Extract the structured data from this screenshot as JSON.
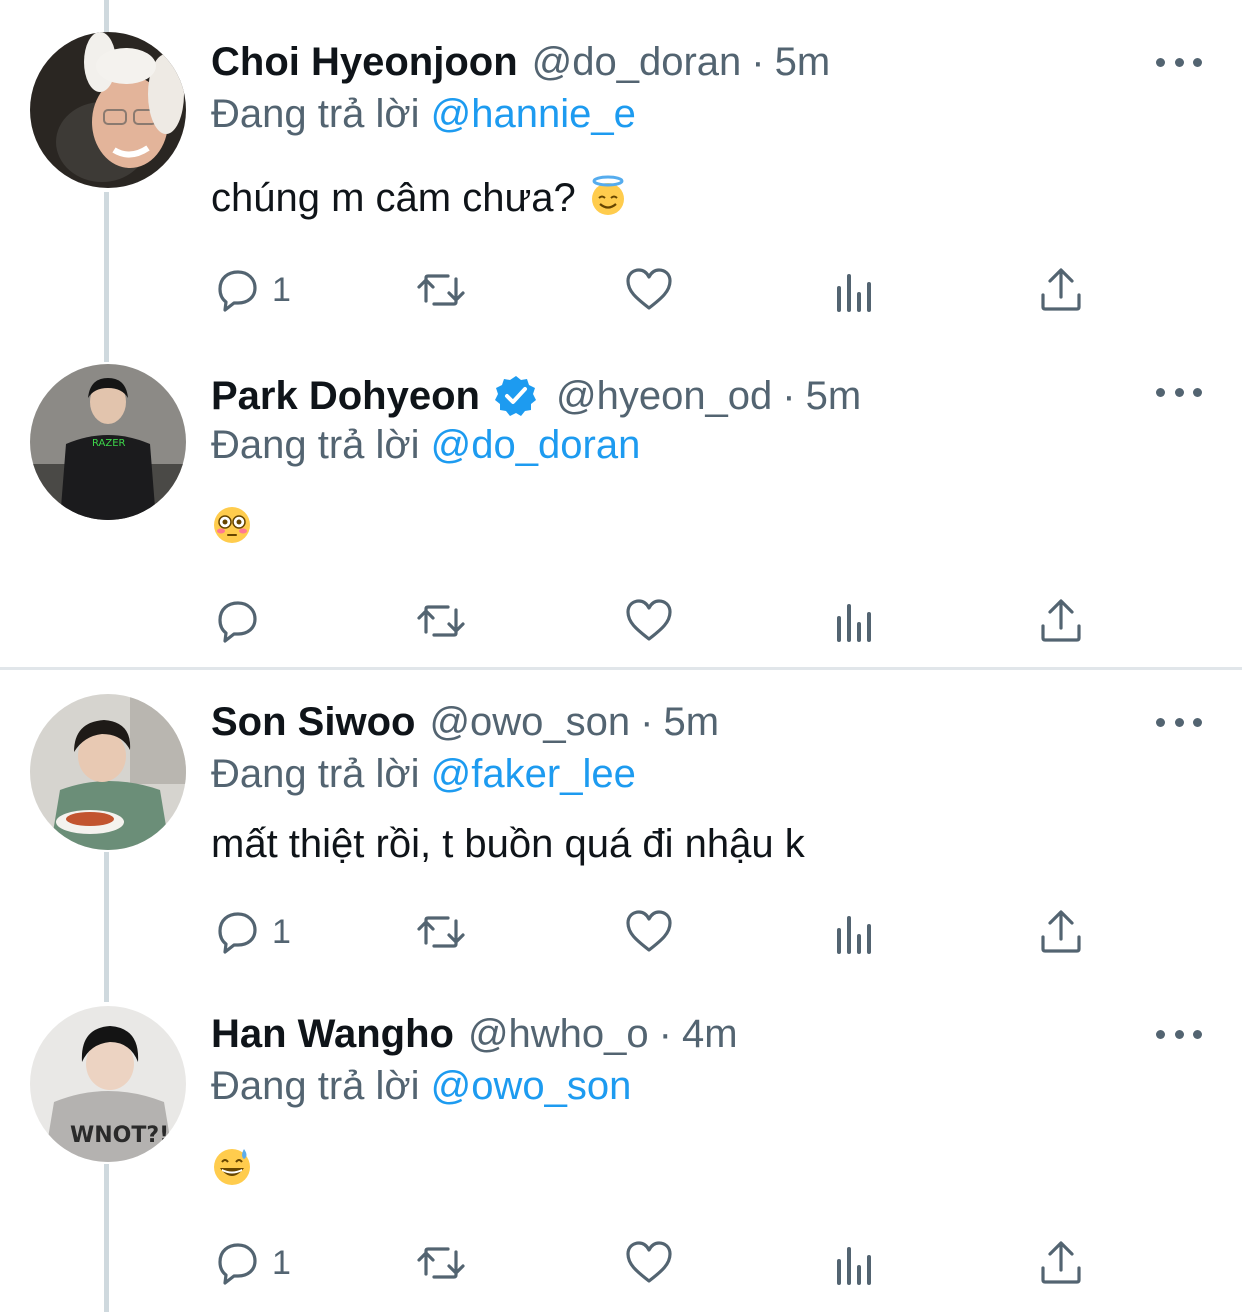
{
  "reply_prefix": "Đang trả lời",
  "accent_color": "#1d9bf0",
  "tweets": [
    {
      "name": "Choi Hyeonjoon",
      "handle": "@do_doran",
      "separator": "·",
      "time": "5m",
      "replying_to": "@hannie_e",
      "text": "chúng m câm chưa?",
      "emoji": "smiling-face-with-halo",
      "verified": false,
      "reply_count": "1"
    },
    {
      "name": "Park Dohyeon",
      "handle": "@hyeon_od",
      "separator": "·",
      "time": "5m",
      "replying_to": "@do_doran",
      "text": "",
      "emoji": "flushed-face",
      "verified": true,
      "reply_count": ""
    },
    {
      "name": "Son Siwoo",
      "handle": "@owo_son",
      "separator": "·",
      "time": "5m",
      "replying_to": "@faker_lee",
      "text": "mất thiệt rồi, t buồn quá đi nhậu k",
      "emoji": "",
      "verified": false,
      "reply_count": "1"
    },
    {
      "name": "Han Wangho",
      "handle": "@hwho_o",
      "separator": "·",
      "time": "4m",
      "replying_to": "@owo_son",
      "text": "",
      "emoji": "grinning-face-with-sweat",
      "verified": false,
      "reply_count": "1"
    }
  ]
}
